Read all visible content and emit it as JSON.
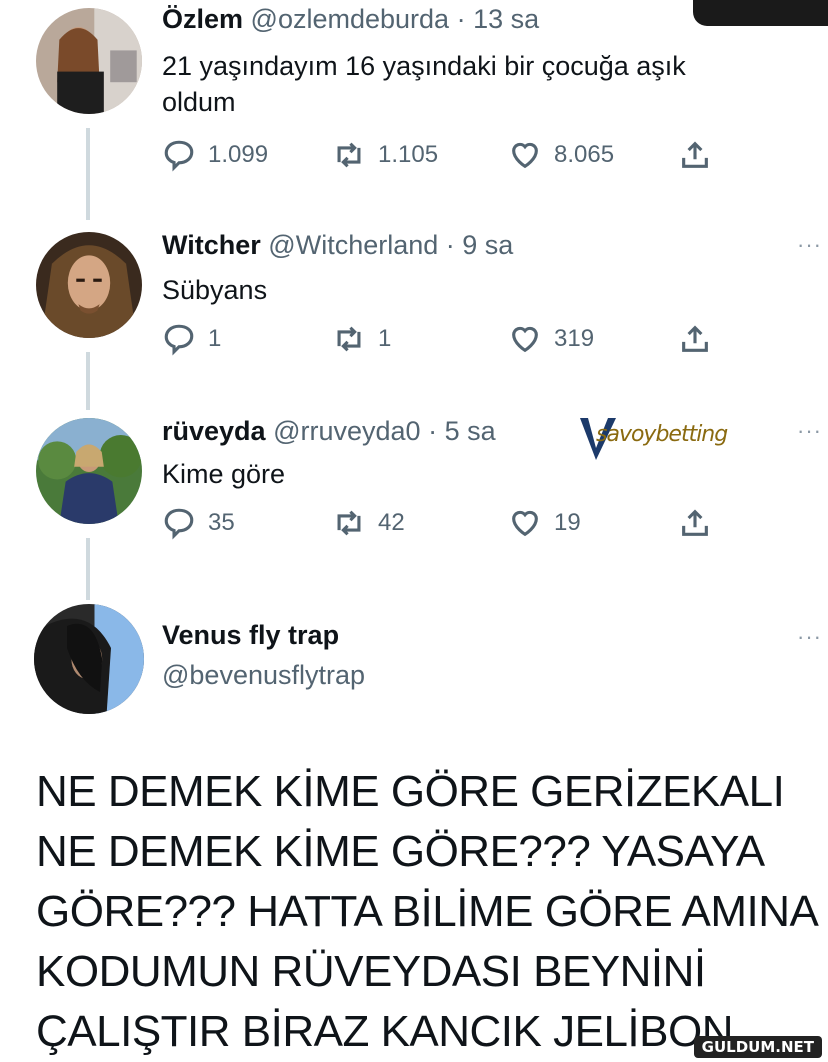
{
  "tweets": [
    {
      "name": "Özlem",
      "handle": "@ozlemdeburda",
      "time": "· 13 sa",
      "text": "21 yaşındayım 16 yaşındaki bir çocuğa aşık oldum",
      "replies": "1.099",
      "retweets": "1.105",
      "likes": "8.065"
    },
    {
      "name": "Witcher",
      "handle": "@Witcherland",
      "time": "· 9 sa",
      "text": "Sübyans",
      "replies": "1",
      "retweets": "1",
      "likes": "319"
    },
    {
      "name": "rüveyda",
      "handle": "@rruveyda0",
      "time": "· 5 sa",
      "text": "Kime göre",
      "replies": "35",
      "retweets": "42",
      "likes": "19"
    },
    {
      "name": "Venus fly trap",
      "handle": "@bevenusflytrap",
      "text": "NE DEMEK KİME GÖRE GERİZEKALI NE DEMEK KİME GÖRE??? YASAYA GÖRE??? HATTA BİLİME GÖRE AMINA KODUMUN RÜVEYDASI BEYNİNİ ÇALIŞTIR BİRAZ KANCIK JELİBON"
    }
  ],
  "more_label": "···",
  "watermark": "savoybetting",
  "site_badge": "GULDUM.NET",
  "icons": [
    "reply-icon",
    "retweet-icon",
    "like-icon",
    "share-icon",
    "more-icon"
  ]
}
